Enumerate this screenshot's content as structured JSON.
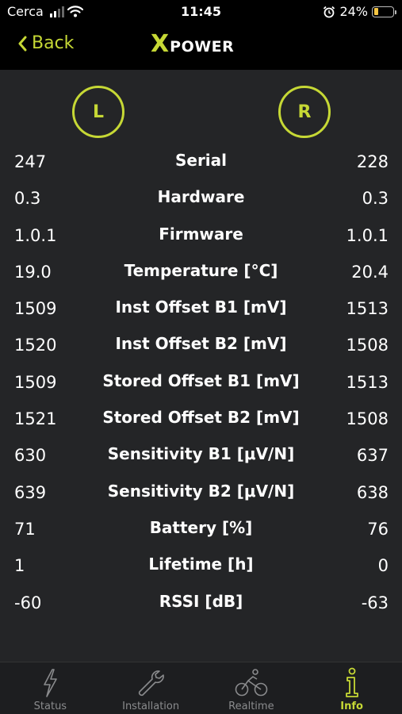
{
  "status_bar": {
    "carrier": "Cerca",
    "time": "11:45",
    "battery_percent": "24%",
    "battery_level": 0.24
  },
  "nav": {
    "back_label": "Back",
    "logo_x": "X",
    "logo_word": "POWER"
  },
  "sides": {
    "left": "L",
    "right": "R"
  },
  "rows": [
    {
      "label": "Serial",
      "left": "247",
      "right": "228"
    },
    {
      "label": "Hardware",
      "left": "0.3",
      "right": "0.3"
    },
    {
      "label": "Firmware",
      "left": "1.0.1",
      "right": "1.0.1"
    },
    {
      "label": "Temperature [°C]",
      "left": "19.0",
      "right": "20.4"
    },
    {
      "label": "Inst Offset B1 [mV]",
      "left": "1509",
      "right": "1513"
    },
    {
      "label": "Inst Offset B2 [mV]",
      "left": "1520",
      "right": "1508"
    },
    {
      "label": "Stored Offset B1 [mV]",
      "left": "1509",
      "right": "1513"
    },
    {
      "label": "Stored Offset B2 [mV]",
      "left": "1521",
      "right": "1508"
    },
    {
      "label": "Sensitivity B1 [μV/N]",
      "left": "630",
      "right": "637"
    },
    {
      "label": "Sensitivity B2 [μV/N]",
      "left": "639",
      "right": "638"
    },
    {
      "label": "Battery [%]",
      "left": "71",
      "right": "76"
    },
    {
      "label": "Lifetime [h]",
      "left": "1",
      "right": "0"
    },
    {
      "label": "RSSI [dB]",
      "left": "-60",
      "right": "-63"
    }
  ],
  "tabs": [
    {
      "label": "Status",
      "icon": "lightning-icon"
    },
    {
      "label": "Installation",
      "icon": "wrench-icon"
    },
    {
      "label": "Realtime",
      "icon": "cyclist-icon"
    },
    {
      "label": "Info",
      "icon": "info-icon"
    }
  ],
  "colors": {
    "accent": "#c6d835",
    "background": "#242527",
    "topbar": "#000000",
    "inactive_tab": "#8a8b8d"
  }
}
